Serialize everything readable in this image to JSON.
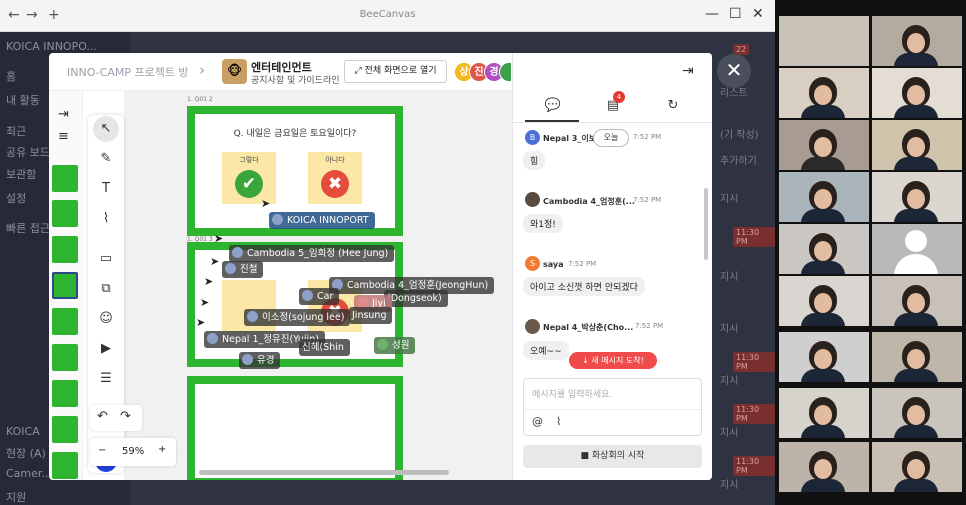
{
  "window": {
    "title": "BeeCanvas",
    "back": "←",
    "forward": "→",
    "new_tab": "+",
    "minimize": "—",
    "maximize": "☐",
    "close": "✕"
  },
  "background_app": {
    "sidebar": [
      "KOICA INNOPO...",
      "홈",
      "내 활동",
      "최근",
      "공유 보드",
      "보관함",
      "설정",
      "빠른 접근",
      "KOICA",
      "현장 (A)",
      "Camer...",
      "지원"
    ],
    "right_items": [
      "리스트",
      "(기 작성)",
      "추가하기",
      "지시",
      "지시",
      "지시",
      "지시",
      "지시",
      "지시"
    ],
    "right_badges": [
      "11:30 PM",
      "11:30 PM",
      "11:30 PM",
      "11:30 PM"
    ],
    "top_badge": "22"
  },
  "modal": {
    "breadcrumb": "INNO-CAMP 프로젝트 방",
    "chevron": "›",
    "board_icon": "🐵",
    "board_title": "엔터테인먼트",
    "board_subtitle": "공지사항 및 가이드라인",
    "fullscreen_label": "전체 화면으로 열기",
    "avatars": [
      {
        "letter": "상",
        "color": "#f2b81c"
      },
      {
        "letter": "진",
        "color": "#e0564a"
      },
      {
        "letter": "경",
        "color": "#b04ec0"
      },
      {
        "letter": "",
        "color": "#3da04a"
      }
    ],
    "collapse_icon": "⇥",
    "close_label": "✕"
  },
  "tools": {
    "left_strip": [
      "⇥",
      "≡"
    ],
    "tools": [
      "↖",
      "✎",
      "T",
      "⌇",
      "▭",
      "⧉",
      "☺",
      "▶",
      "☰"
    ],
    "undo": "↶",
    "redo": "↷",
    "zoom": "59%",
    "zoom_out": "−",
    "zoom_in": "+"
  },
  "canvas": {
    "page1_tag": "1. Q01 2",
    "page2_tag": "1. Q01 3",
    "question": "Q. 내일은 금요일은 토요일이다?",
    "note_yes": "그렇다",
    "note_no": "아니다",
    "check": "✔",
    "xmark": "✖",
    "koica_label": "KOICA INNOPORT",
    "cursors": [
      "Cambodia 5_임희정 (Hee Jung)",
      "진철",
      "Cambodia 4_엄정훈(JeongHun)",
      "Car",
      "Jiyi",
      "이소정(sojung lee)",
      "Nepal 1_정유진(Yujin)",
      "성원",
      "유경",
      "(Dongseok)",
      "Jinsung",
      "신혜(Shin"
    ]
  },
  "chat": {
    "tabs": [
      "chat-icon",
      "notes-icon",
      "history-icon"
    ],
    "notes_badge": "4",
    "today": "오늘",
    "messages": [
      {
        "name": "Nepal 3_이보",
        "time": "7:52 PM",
        "text": "힝",
        "avatar": "B",
        "color": "#4a6fd8"
      },
      {
        "name": "Cambodia 4_엄정훈(...",
        "time": "7:52 PM",
        "text": "와1정!",
        "avatar": "",
        "color": "#5b4a3e"
      },
      {
        "name": "saya",
        "time": "7:52 PM",
        "text": "아이고 소신껏 하면 안되겠다",
        "avatar": "S",
        "color": "#f07a30"
      },
      {
        "name": "Nepal 4_박상춘(Cho...",
        "time": "7:52 PM",
        "text": "오예~~",
        "avatar": "",
        "color": "#6a5a4a"
      }
    ],
    "new_message": "↓ 새 메시지 도착!",
    "placeholder": "메시지를 입력하세요.",
    "mention": "@",
    "attach": "⌇",
    "video_meeting": "화상회의 시작"
  }
}
